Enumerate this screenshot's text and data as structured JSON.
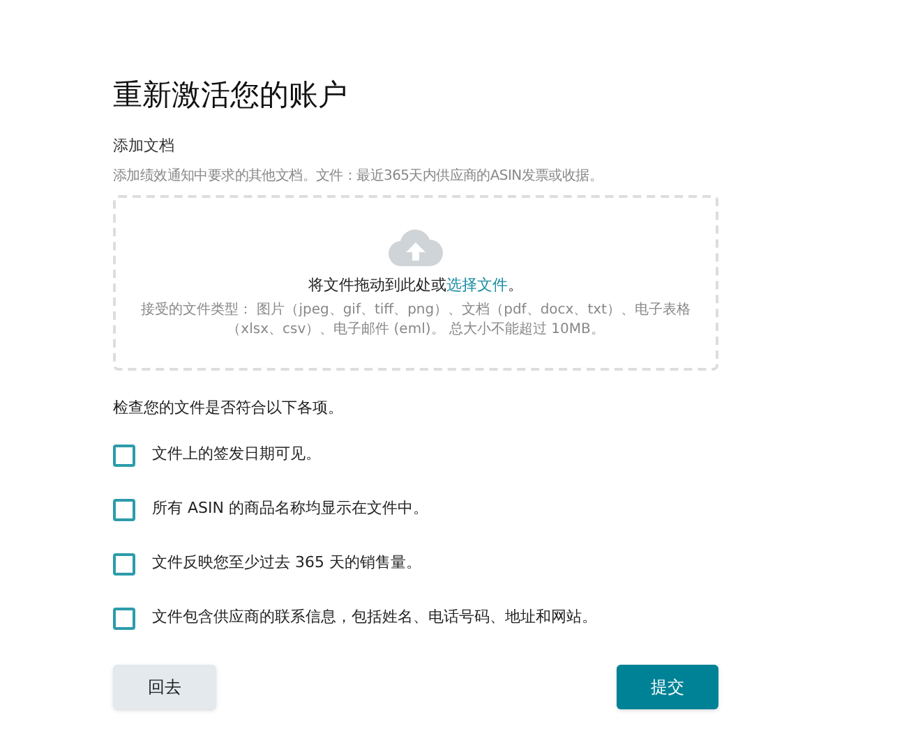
{
  "title": "重新激活您的账户",
  "section": {
    "label": "添加文档",
    "description": "添加绩效通知中要求的其他文档。文件：最近365天内供应商的ASIN发票或收据。"
  },
  "dropzone": {
    "prompt": "将文件拖动到此处或",
    "link": "选择文件",
    "prompt_end": "。",
    "accepted": "接受的文件类型： 图片（jpeg、gif、tiff、png）、文档（pdf、docx、txt）、电子表格（xlsx、csv）、电子邮件 (eml)。 总大小不能超过 10MB。"
  },
  "checklist": {
    "heading": "检查您的文件是否符合以下各项。",
    "items": [
      {
        "label": "文件上的签发日期可见。",
        "checked": false
      },
      {
        "label": "所有 ASIN 的商品名称均显示在文件中。",
        "checked": false
      },
      {
        "label": "文件反映您至少过去 365 天的销售量。",
        "checked": false
      },
      {
        "label": "文件包含供应商的联系信息，包括姓名、电话号码、地址和网站。",
        "checked": false
      }
    ]
  },
  "buttons": {
    "back": "回去",
    "submit": "提交"
  }
}
